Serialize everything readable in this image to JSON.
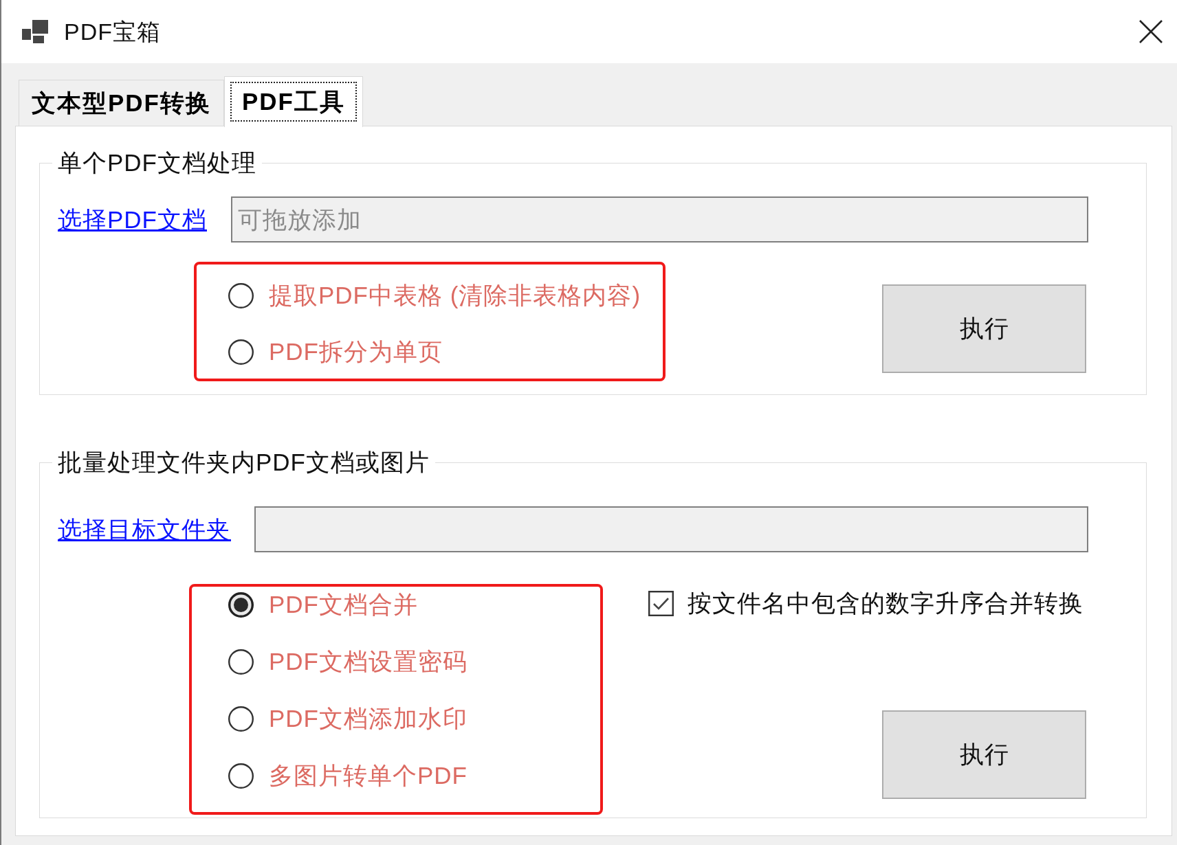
{
  "window": {
    "title": "PDF宝箱"
  },
  "tabs": [
    {
      "label": "文本型PDF转换",
      "selected": false
    },
    {
      "label": "PDF工具",
      "selected": true
    }
  ],
  "groups": [
    {
      "title": "单个PDF文档处理",
      "link": "选择PDF文档",
      "field": {
        "placeholder": "可拖放添加"
      },
      "options": [
        {
          "label": "提取PDF中表格 (清除非表格内容)",
          "selected": false
        },
        {
          "label": "PDF拆分为单页",
          "selected": false
        }
      ],
      "button": "执行"
    },
    {
      "title": "批量处理文件夹内PDF文档或图片",
      "link": "选择目标文件夹",
      "options": [
        {
          "label": "PDF文档合并",
          "selected": true
        },
        {
          "label": "PDF文档设置密码",
          "selected": false
        },
        {
          "label": "PDF文档添加水印",
          "selected": false
        },
        {
          "label": "多图片转单个PDF",
          "selected": false
        }
      ],
      "checkbox": {
        "label": "按文件名中包含的数字升序合并转换",
        "checked": true
      },
      "button": "执行"
    }
  ]
}
